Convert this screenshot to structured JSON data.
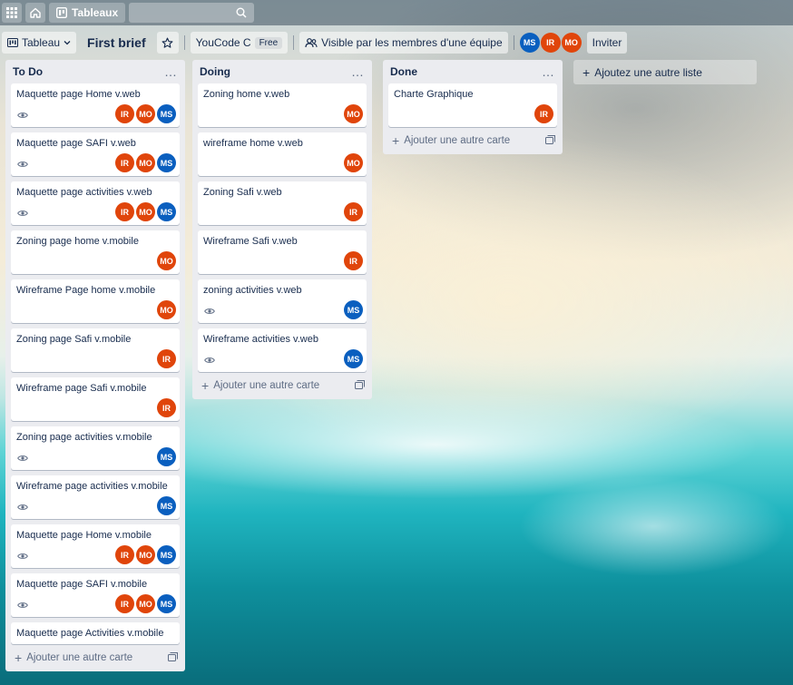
{
  "topbar": {
    "boards_label": "Tableaux",
    "icons": [
      "apps-icon",
      "home-icon",
      "boards-icon",
      "search-icon"
    ]
  },
  "header": {
    "view_label": "Tableau",
    "board_title": "First brief",
    "workspace_name": "YouCode C",
    "plan_badge": "Free",
    "visibility_label": "Visible par les membres d'une équipe",
    "members": [
      "MS",
      "IR",
      "MO"
    ],
    "invite_label": "Inviter"
  },
  "colors": {
    "IR": "#e0450b",
    "MO": "#e0450b",
    "MS": "#0a5fbf"
  },
  "lists": [
    {
      "title": "To Do",
      "cards": [
        {
          "title": "Maquette page Home v.web",
          "eye": true,
          "members": [
            "IR",
            "MO",
            "MS"
          ]
        },
        {
          "title": "Maquette page SAFI v.web",
          "eye": true,
          "members": [
            "IR",
            "MO",
            "MS"
          ]
        },
        {
          "title": "Maquette page activities v.web",
          "eye": true,
          "members": [
            "IR",
            "MO",
            "MS"
          ]
        },
        {
          "title": "Zoning page home v.mobile",
          "eye": false,
          "members": [
            "MO"
          ]
        },
        {
          "title": "Wireframe Page home v.mobile",
          "eye": false,
          "members": [
            "MO"
          ]
        },
        {
          "title": "Zoning page Safi v.mobile",
          "eye": false,
          "members": [
            "IR"
          ]
        },
        {
          "title": "Wireframe page Safi v.mobile",
          "eye": false,
          "members": [
            "IR"
          ]
        },
        {
          "title": "Zoning page activities v.mobile",
          "eye": true,
          "members": [
            "MS"
          ]
        },
        {
          "title": "Wireframe page activities v.mobile",
          "eye": true,
          "members": [
            "MS"
          ]
        },
        {
          "title": "Maquette page Home v.mobile",
          "eye": true,
          "members": [
            "IR",
            "MO",
            "MS"
          ]
        },
        {
          "title": "Maquette page SAFI v.mobile",
          "eye": true,
          "members": [
            "IR",
            "MO",
            "MS"
          ]
        },
        {
          "title": "Maquette page Activities v.mobile",
          "eye": false,
          "members": [],
          "partial": true
        }
      ],
      "add_card_label": "Ajouter une autre carte"
    },
    {
      "title": "Doing",
      "cards": [
        {
          "title": "Zoning home v.web",
          "eye": false,
          "members": [
            "MO"
          ]
        },
        {
          "title": "wireframe home v.web",
          "eye": false,
          "members": [
            "MO"
          ]
        },
        {
          "title": "Zoning Safi v.web",
          "eye": false,
          "members": [
            "IR"
          ]
        },
        {
          "title": "Wireframe Safi v.web",
          "eye": false,
          "members": [
            "IR"
          ]
        },
        {
          "title": "zoning activities v.web",
          "eye": true,
          "members": [
            "MS"
          ]
        },
        {
          "title": "Wireframe activities v.web",
          "eye": true,
          "members": [
            "MS"
          ]
        }
      ],
      "add_card_label": "Ajouter une autre carte"
    },
    {
      "title": "Done",
      "cards": [
        {
          "title": "Charte Graphique",
          "eye": false,
          "members": [
            "IR"
          ]
        }
      ],
      "add_card_label": "Ajouter une autre carte"
    }
  ],
  "add_list_label": "Ajoutez une autre liste"
}
